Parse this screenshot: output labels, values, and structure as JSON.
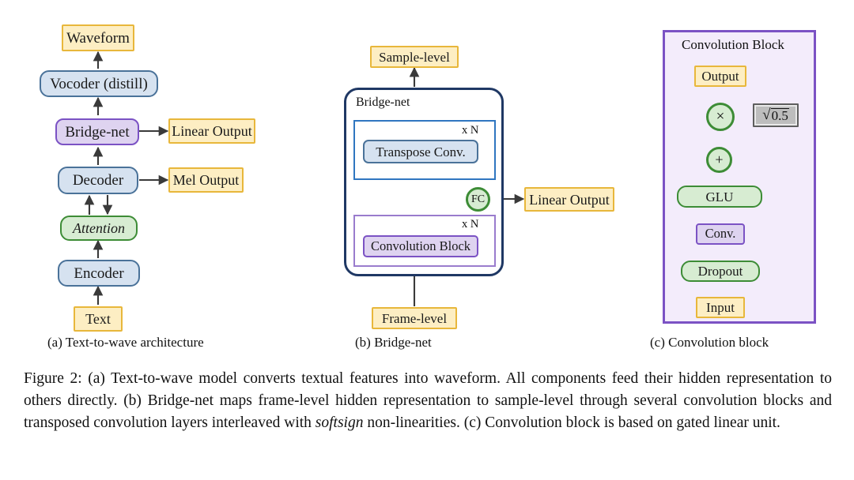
{
  "figure": {
    "caption_parts": {
      "p1": "Figure 2: (a) Text-to-wave model converts textual features into waveform. All components feed their hidden representation to others directly. (b) Bridge-net maps frame-level hidden representation to sample-level through several convolution blocks and transposed convolution layers interleaved with ",
      "softsign": "softsign",
      "p2": " non-linearities. (c) Convolution block is based on gated linear unit."
    }
  },
  "panel_a": {
    "subcaption": "(a) Text-to-wave architecture",
    "nodes": {
      "waveform": "Waveform",
      "vocoder": "Vocoder (distill)",
      "bridge_net": "Bridge-net",
      "linear_output": "Linear Output",
      "decoder": "Decoder",
      "mel_output": "Mel Output",
      "attention": "Attention",
      "encoder": "Encoder",
      "text": "Text"
    }
  },
  "panel_b": {
    "subcaption": "(b) Bridge-net",
    "nodes": {
      "sample_level": "Sample-level",
      "bridge_net_label": "Bridge-net",
      "transpose_conv": "Transpose Conv.",
      "transpose_repeat": "x N",
      "fc": "FC",
      "linear_output": "Linear Output",
      "convolution_block": "Convolution  Block",
      "conv_repeat": "x N",
      "frame_level": "Frame-level"
    }
  },
  "panel_c": {
    "subcaption": "(c) Convolution block",
    "nodes": {
      "block_title": "Convolution Block",
      "output": "Output",
      "multiply": "×",
      "sqrt_symbol": "√",
      "sqrt_value": "0.5",
      "add": "+",
      "glu": "GLU",
      "conv": "Conv.",
      "dropout": "Dropout",
      "input": "Input"
    }
  },
  "colors": {
    "yellow_fill": "#fdeec3",
    "yellow_stroke": "#e8b73b",
    "blue_fill": "#d6e2f0",
    "blue_stroke": "#4a7299",
    "purple_fill": "#ded3f0",
    "purple_stroke": "#7b52c4",
    "green_fill": "#d7ecd2",
    "green_stroke": "#3d8c36",
    "gray_fill": "#bdbdbd",
    "navy_stroke": "#1f3864",
    "arrow": "#3a3a3a"
  }
}
